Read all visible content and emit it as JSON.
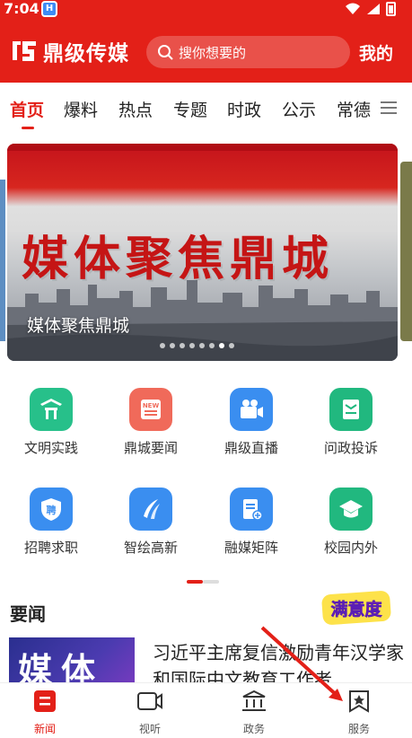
{
  "status_bar": {
    "time": "7:04",
    "app_icon_letter": "H"
  },
  "header": {
    "logo_text": "鼎级传媒",
    "search_placeholder": "搜你想要的",
    "my_label": "我的",
    "brand_color": "#e32018"
  },
  "tabs": [
    {
      "label": "首页",
      "active": true
    },
    {
      "label": "爆料"
    },
    {
      "label": "热点"
    },
    {
      "label": "专题"
    },
    {
      "label": "时政"
    },
    {
      "label": "公示"
    },
    {
      "label": "常德"
    }
  ],
  "banner": {
    "big_text": "媒体聚焦鼎城",
    "caption": "媒体聚焦鼎城",
    "slide_count": 8,
    "active_slide": 7
  },
  "grid": [
    {
      "label": "文明实践",
      "icon": "civilization-icon",
      "color": "#27c08a",
      "glyph": "⛩"
    },
    {
      "label": "鼎城要闻",
      "icon": "news-icon",
      "color": "#f06a5a",
      "glyph": "NEW"
    },
    {
      "label": "鼎级直播",
      "icon": "live-icon",
      "color": "#3a8ef0",
      "glyph": "▶"
    },
    {
      "label": "问政投诉",
      "icon": "complaint-icon",
      "color": "#21b87f",
      "glyph": "✉"
    },
    {
      "label": "招聘求职",
      "icon": "recruit-icon",
      "color": "#3a8ef0",
      "glyph": "聘"
    },
    {
      "label": "智绘高新",
      "icon": "hitech-icon",
      "color": "#3a8ef0",
      "glyph": "✦"
    },
    {
      "label": "融媒矩阵",
      "icon": "media-matrix-icon",
      "color": "#3a8ef0",
      "glyph": "▤"
    },
    {
      "label": "校园内外",
      "icon": "campus-icon",
      "color": "#21b87f",
      "glyph": "🎓"
    }
  ],
  "news": {
    "section_title": "要闻",
    "thumb_text": "媒体",
    "headline": "习近平主席复信激励青年汉学家和国际中文教育工作者"
  },
  "badge_text": "满意度",
  "bottom_nav": [
    {
      "label": "新闻",
      "icon": "news-nav-icon",
      "active": true
    },
    {
      "label": "视听",
      "icon": "video-nav-icon"
    },
    {
      "label": "政务",
      "icon": "government-nav-icon"
    },
    {
      "label": "服务",
      "icon": "service-nav-icon"
    }
  ]
}
